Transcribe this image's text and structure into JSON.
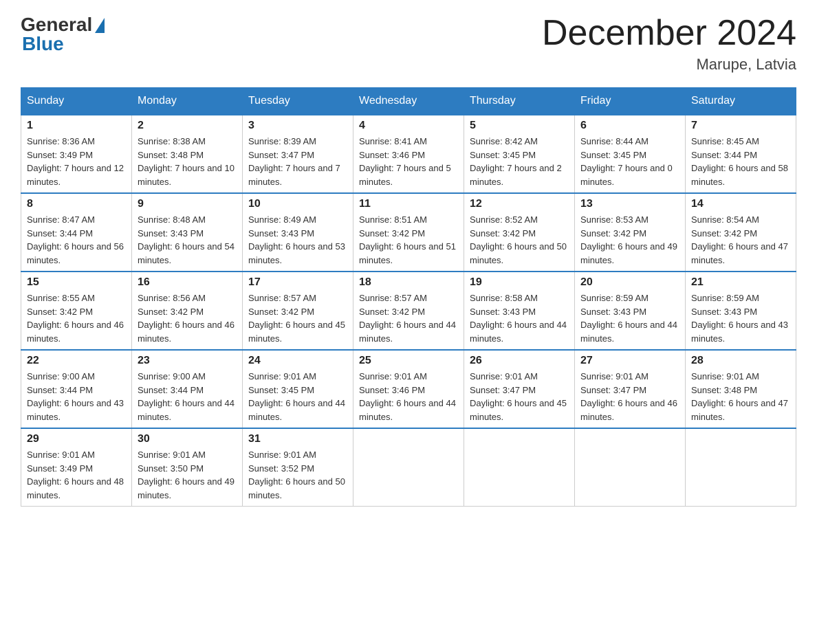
{
  "logo": {
    "general": "General",
    "blue": "Blue"
  },
  "title": {
    "month": "December 2024",
    "location": "Marupe, Latvia"
  },
  "weekdays": [
    "Sunday",
    "Monday",
    "Tuesday",
    "Wednesday",
    "Thursday",
    "Friday",
    "Saturday"
  ],
  "weeks": [
    [
      {
        "day": "1",
        "sunrise": "8:36 AM",
        "sunset": "3:49 PM",
        "daylight": "7 hours and 12 minutes."
      },
      {
        "day": "2",
        "sunrise": "8:38 AM",
        "sunset": "3:48 PM",
        "daylight": "7 hours and 10 minutes."
      },
      {
        "day": "3",
        "sunrise": "8:39 AM",
        "sunset": "3:47 PM",
        "daylight": "7 hours and 7 minutes."
      },
      {
        "day": "4",
        "sunrise": "8:41 AM",
        "sunset": "3:46 PM",
        "daylight": "7 hours and 5 minutes."
      },
      {
        "day": "5",
        "sunrise": "8:42 AM",
        "sunset": "3:45 PM",
        "daylight": "7 hours and 2 minutes."
      },
      {
        "day": "6",
        "sunrise": "8:44 AM",
        "sunset": "3:45 PM",
        "daylight": "7 hours and 0 minutes."
      },
      {
        "day": "7",
        "sunrise": "8:45 AM",
        "sunset": "3:44 PM",
        "daylight": "6 hours and 58 minutes."
      }
    ],
    [
      {
        "day": "8",
        "sunrise": "8:47 AM",
        "sunset": "3:44 PM",
        "daylight": "6 hours and 56 minutes."
      },
      {
        "day": "9",
        "sunrise": "8:48 AM",
        "sunset": "3:43 PM",
        "daylight": "6 hours and 54 minutes."
      },
      {
        "day": "10",
        "sunrise": "8:49 AM",
        "sunset": "3:43 PM",
        "daylight": "6 hours and 53 minutes."
      },
      {
        "day": "11",
        "sunrise": "8:51 AM",
        "sunset": "3:42 PM",
        "daylight": "6 hours and 51 minutes."
      },
      {
        "day": "12",
        "sunrise": "8:52 AM",
        "sunset": "3:42 PM",
        "daylight": "6 hours and 50 minutes."
      },
      {
        "day": "13",
        "sunrise": "8:53 AM",
        "sunset": "3:42 PM",
        "daylight": "6 hours and 49 minutes."
      },
      {
        "day": "14",
        "sunrise": "8:54 AM",
        "sunset": "3:42 PM",
        "daylight": "6 hours and 47 minutes."
      }
    ],
    [
      {
        "day": "15",
        "sunrise": "8:55 AM",
        "sunset": "3:42 PM",
        "daylight": "6 hours and 46 minutes."
      },
      {
        "day": "16",
        "sunrise": "8:56 AM",
        "sunset": "3:42 PM",
        "daylight": "6 hours and 46 minutes."
      },
      {
        "day": "17",
        "sunrise": "8:57 AM",
        "sunset": "3:42 PM",
        "daylight": "6 hours and 45 minutes."
      },
      {
        "day": "18",
        "sunrise": "8:57 AM",
        "sunset": "3:42 PM",
        "daylight": "6 hours and 44 minutes."
      },
      {
        "day": "19",
        "sunrise": "8:58 AM",
        "sunset": "3:43 PM",
        "daylight": "6 hours and 44 minutes."
      },
      {
        "day": "20",
        "sunrise": "8:59 AM",
        "sunset": "3:43 PM",
        "daylight": "6 hours and 44 minutes."
      },
      {
        "day": "21",
        "sunrise": "8:59 AM",
        "sunset": "3:43 PM",
        "daylight": "6 hours and 43 minutes."
      }
    ],
    [
      {
        "day": "22",
        "sunrise": "9:00 AM",
        "sunset": "3:44 PM",
        "daylight": "6 hours and 43 minutes."
      },
      {
        "day": "23",
        "sunrise": "9:00 AM",
        "sunset": "3:44 PM",
        "daylight": "6 hours and 44 minutes."
      },
      {
        "day": "24",
        "sunrise": "9:01 AM",
        "sunset": "3:45 PM",
        "daylight": "6 hours and 44 minutes."
      },
      {
        "day": "25",
        "sunrise": "9:01 AM",
        "sunset": "3:46 PM",
        "daylight": "6 hours and 44 minutes."
      },
      {
        "day": "26",
        "sunrise": "9:01 AM",
        "sunset": "3:47 PM",
        "daylight": "6 hours and 45 minutes."
      },
      {
        "day": "27",
        "sunrise": "9:01 AM",
        "sunset": "3:47 PM",
        "daylight": "6 hours and 46 minutes."
      },
      {
        "day": "28",
        "sunrise": "9:01 AM",
        "sunset": "3:48 PM",
        "daylight": "6 hours and 47 minutes."
      }
    ],
    [
      {
        "day": "29",
        "sunrise": "9:01 AM",
        "sunset": "3:49 PM",
        "daylight": "6 hours and 48 minutes."
      },
      {
        "day": "30",
        "sunrise": "9:01 AM",
        "sunset": "3:50 PM",
        "daylight": "6 hours and 49 minutes."
      },
      {
        "day": "31",
        "sunrise": "9:01 AM",
        "sunset": "3:52 PM",
        "daylight": "6 hours and 50 minutes."
      },
      null,
      null,
      null,
      null
    ]
  ]
}
